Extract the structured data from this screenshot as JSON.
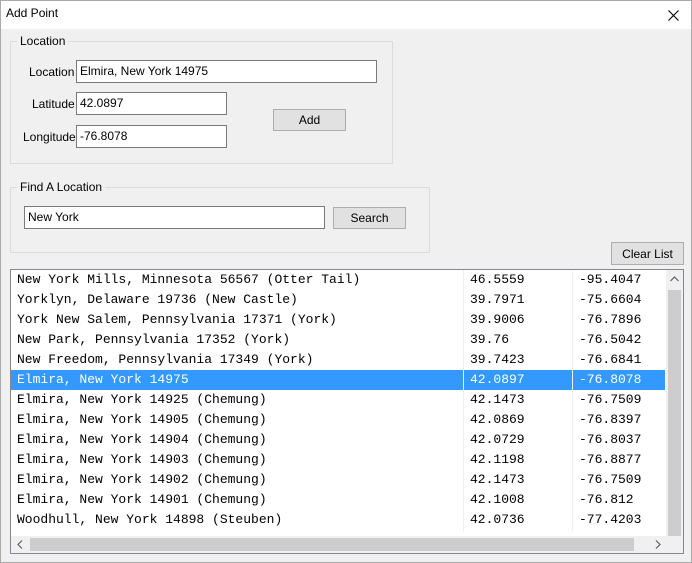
{
  "window": {
    "title": "Add Point"
  },
  "location_group": {
    "legend": "Location",
    "location_label": "Location",
    "location_value": "Elmira, New York 14975",
    "latitude_label": "Latitude",
    "latitude_value": "42.0897",
    "longitude_label": "Longitude",
    "longitude_value": "-76.8078",
    "add_label": "Add"
  },
  "find_group": {
    "legend": "Find A Location",
    "search_value": "New York",
    "search_label": "Search"
  },
  "clear_label": "Clear List",
  "results": {
    "selected_index": 5,
    "rows": [
      {
        "name": "New York Mills, Minnesota 56567 (Otter Tail)",
        "lat": "46.5559",
        "lon": "-95.4047"
      },
      {
        "name": "Yorklyn, Delaware 19736 (New Castle)",
        "lat": "39.7971",
        "lon": "-75.6604"
      },
      {
        "name": "York New Salem, Pennsylvania 17371 (York)",
        "lat": "39.9006",
        "lon": "-76.7896"
      },
      {
        "name": "New Park, Pennsylvania 17352 (York)",
        "lat": "39.76",
        "lon": "-76.5042"
      },
      {
        "name": "New Freedom, Pennsylvania 17349 (York)",
        "lat": "39.7423",
        "lon": "-76.6841"
      },
      {
        "name": "Elmira, New York 14975",
        "lat": "42.0897",
        "lon": "-76.8078"
      },
      {
        "name": "Elmira, New York 14925 (Chemung)",
        "lat": "42.1473",
        "lon": "-76.7509"
      },
      {
        "name": "Elmira, New York 14905 (Chemung)",
        "lat": "42.0869",
        "lon": "-76.8397"
      },
      {
        "name": "Elmira, New York 14904 (Chemung)",
        "lat": "42.0729",
        "lon": "-76.8037"
      },
      {
        "name": "Elmira, New York 14903 (Chemung)",
        "lat": "42.1198",
        "lon": "-76.8877"
      },
      {
        "name": "Elmira, New York 14902 (Chemung)",
        "lat": "42.1473",
        "lon": "-76.7509"
      },
      {
        "name": "Elmira, New York 14901 (Chemung)",
        "lat": "42.1008",
        "lon": "-76.812"
      },
      {
        "name": "Woodhull, New York 14898 (Steuben)",
        "lat": "42.0736",
        "lon": "-77.4203"
      }
    ]
  },
  "icons": {
    "close": "close-icon",
    "scroll_up": "chevron-up-icon",
    "scroll_down": "chevron-down-icon",
    "scroll_left": "chevron-left-icon",
    "scroll_right": "chevron-right-icon"
  },
  "colors": {
    "selection": "#3399ff",
    "window_bg": "#f0f0f0"
  }
}
